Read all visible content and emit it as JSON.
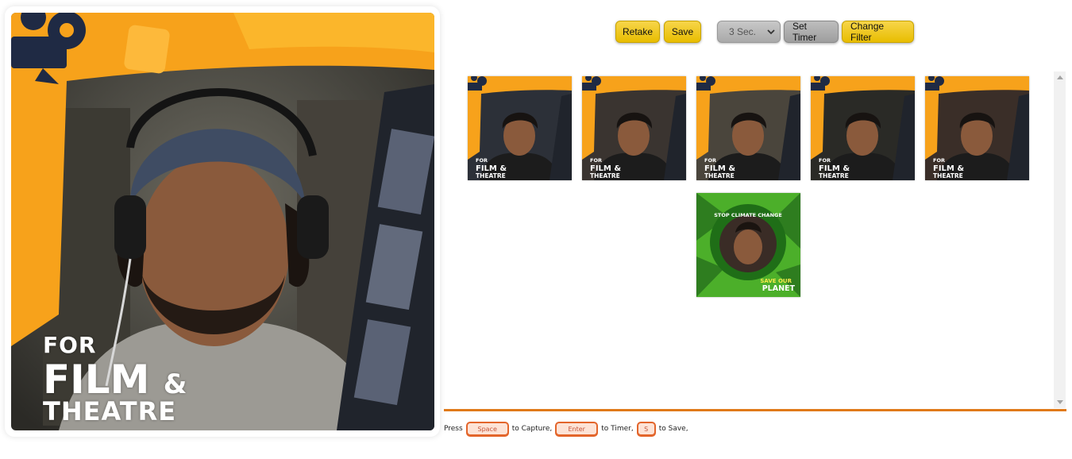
{
  "toolbar": {
    "retake_label": "Retake",
    "save_label": "Save",
    "timer_select_value": "3 Sec.",
    "set_timer_label": "Set Timer",
    "change_filter_label": "Change Filter"
  },
  "preview": {
    "frame_line1": "FOR",
    "frame_line2": "FILM",
    "frame_amp": "&",
    "frame_line3": "THEATRE"
  },
  "gallery": {
    "thumbnails": [
      {
        "filter": "film-theatre",
        "l1": "FOR",
        "l2": "FILM &",
        "l3": "THEATRE"
      },
      {
        "filter": "film-theatre",
        "l1": "FOR",
        "l2": "FILM &",
        "l3": "THEATRE"
      },
      {
        "filter": "film-theatre",
        "l1": "FOR",
        "l2": "FILM &",
        "l3": "THEATRE"
      },
      {
        "filter": "film-theatre",
        "l1": "FOR",
        "l2": "FILM &",
        "l3": "THEATRE"
      },
      {
        "filter": "film-theatre",
        "l1": "FOR",
        "l2": "FILM &",
        "l3": "THEATRE"
      },
      {
        "filter": "climate",
        "top_text": "STOP CLIMATE CHANGE",
        "l1": "SAVE OUR",
        "l2": "PLANET"
      }
    ]
  },
  "hints": {
    "press": "Press",
    "key_space": "Space",
    "to_capture": "to Capture,",
    "key_enter": "Enter",
    "to_timer": "to Timer,",
    "key_s": "S",
    "to_save": "to Save,"
  },
  "colors": {
    "accent_orange": "#f7a21b",
    "divider": "#e07a1a",
    "button_yellow": "#f0c81e",
    "navy": "#1f2a44",
    "climate_green": "#4caf2a"
  }
}
